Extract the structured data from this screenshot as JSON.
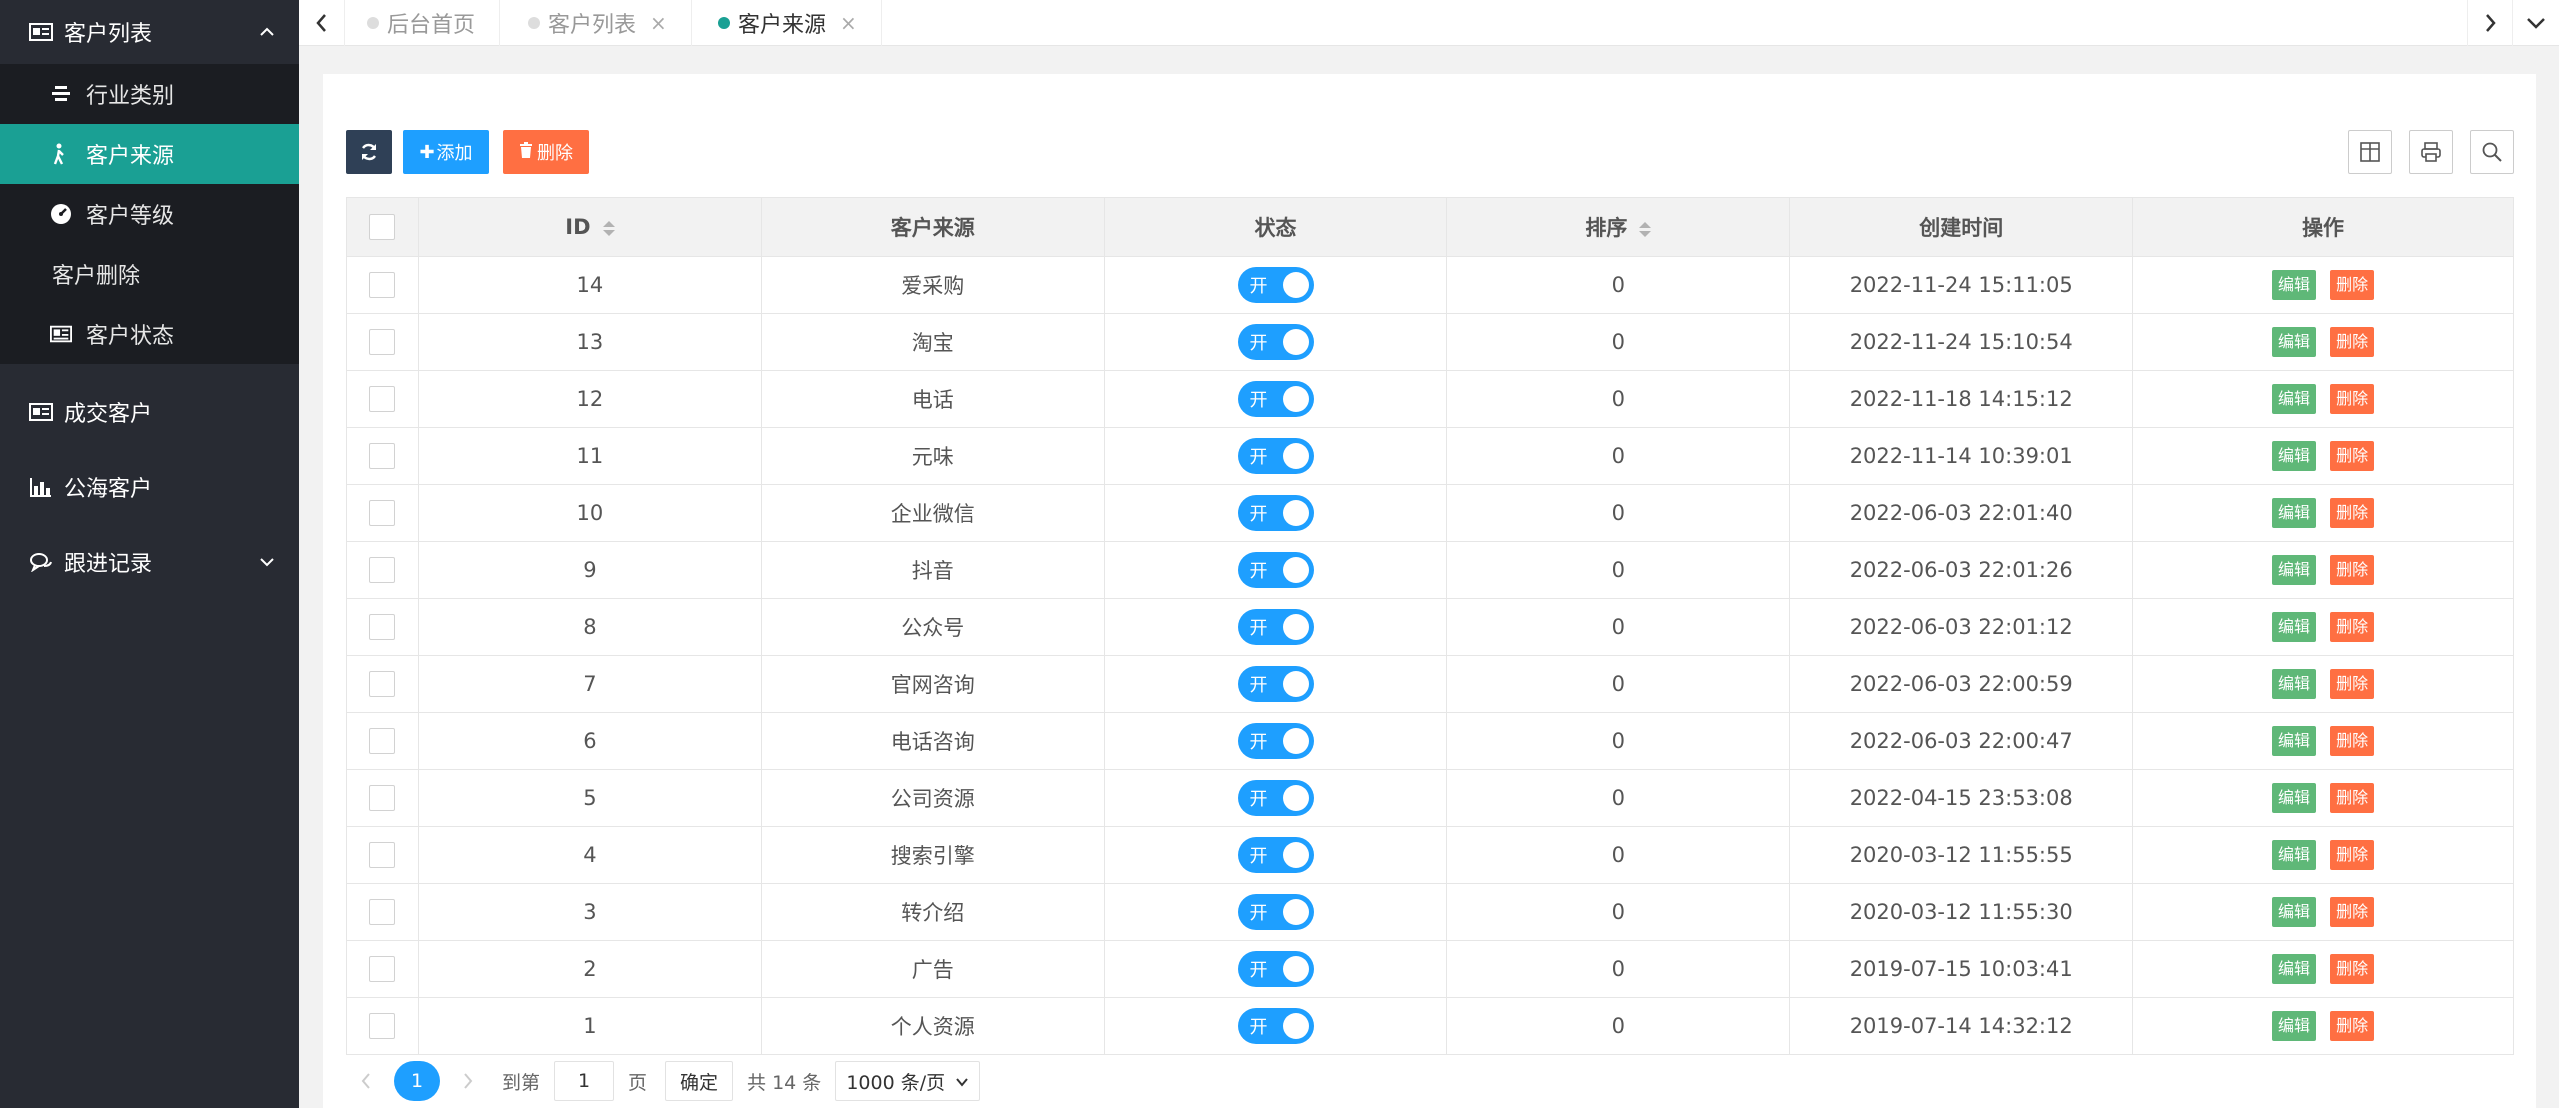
{
  "sidebar": {
    "groups": [
      {
        "label": "客户列表",
        "icon": "id-card-icon",
        "expanded": true,
        "items": [
          {
            "label": "行业类别",
            "icon": "layers-icon",
            "active": false
          },
          {
            "label": "客户来源",
            "icon": "walker-icon",
            "active": true
          },
          {
            "label": "客户等级",
            "icon": "gauge-icon",
            "active": false
          },
          {
            "label": "客户删除",
            "icon": "",
            "active": false
          },
          {
            "label": "客户状态",
            "icon": "newspaper-icon",
            "active": false
          }
        ]
      },
      {
        "label": "成交客户",
        "icon": "id-card-icon"
      },
      {
        "label": "公海客户",
        "icon": "bar-chart-icon"
      },
      {
        "label": "跟进记录",
        "icon": "chat-icon",
        "expanded": false
      }
    ]
  },
  "tabs": [
    {
      "label": "后台首页",
      "active": false,
      "closable": false
    },
    {
      "label": "客户列表",
      "active": false,
      "closable": true
    },
    {
      "label": "客户来源",
      "active": true,
      "closable": true
    }
  ],
  "toolbar": {
    "add_label": "添加",
    "delete_label": "删除"
  },
  "table": {
    "headers": [
      "ID",
      "客户来源",
      "状态",
      "排序",
      "创建时间",
      "操作"
    ],
    "switch_on_label": "开",
    "edit_label": "编辑",
    "delete_label": "删除",
    "rows": [
      {
        "id": "14",
        "source": "爱采购",
        "sort": "0",
        "created": "2022-11-24 15:11:05"
      },
      {
        "id": "13",
        "source": "淘宝",
        "sort": "0",
        "created": "2022-11-24 15:10:54"
      },
      {
        "id": "12",
        "source": "电话",
        "sort": "0",
        "created": "2022-11-18 14:15:12"
      },
      {
        "id": "11",
        "source": "元味",
        "sort": "0",
        "created": "2022-11-14 10:39:01"
      },
      {
        "id": "10",
        "source": "企业微信",
        "sort": "0",
        "created": "2022-06-03 22:01:40"
      },
      {
        "id": "9",
        "source": "抖音",
        "sort": "0",
        "created": "2022-06-03 22:01:26"
      },
      {
        "id": "8",
        "source": "公众号",
        "sort": "0",
        "created": "2022-06-03 22:01:12"
      },
      {
        "id": "7",
        "source": "官网咨询",
        "sort": "0",
        "created": "2022-06-03 22:00:59"
      },
      {
        "id": "6",
        "source": "电话咨询",
        "sort": "0",
        "created": "2022-06-03 22:00:47"
      },
      {
        "id": "5",
        "source": "公司资源",
        "sort": "0",
        "created": "2022-04-15 23:53:08"
      },
      {
        "id": "4",
        "source": "搜索引擎",
        "sort": "0",
        "created": "2020-03-12 11:55:55"
      },
      {
        "id": "3",
        "source": "转介绍",
        "sort": "0",
        "created": "2020-03-12 11:55:30"
      },
      {
        "id": "2",
        "source": "广告",
        "sort": "0",
        "created": "2019-07-15 10:03:41"
      },
      {
        "id": "1",
        "source": "个人资源",
        "sort": "0",
        "created": "2019-07-14 14:32:12"
      }
    ]
  },
  "pager": {
    "current": "1",
    "goto_label": "到第",
    "goto_value": "1",
    "page_label": "页",
    "confirm_label": "确定",
    "total_label": "共 14 条",
    "page_size": "1000 条/页"
  },
  "colors": {
    "sidebar_bg": "#282b33",
    "active": "#1aa094",
    "primary": "#1e9fff",
    "danger": "#ff5722",
    "success": "#5fb878"
  }
}
